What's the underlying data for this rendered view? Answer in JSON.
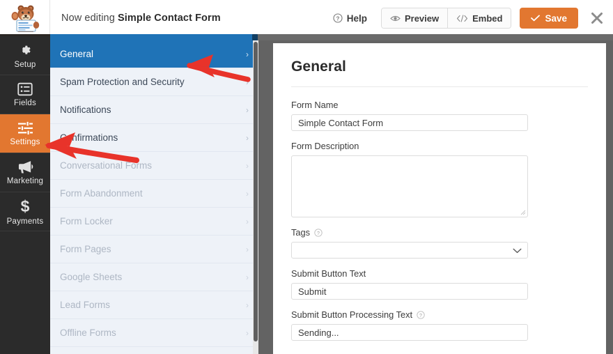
{
  "header": {
    "logo_name": "wpforms-bear-logo",
    "editing_prefix": "Now editing",
    "form_title": "Simple Contact Form",
    "help_label": "Help",
    "preview_label": "Preview",
    "embed_label": "Embed",
    "save_label": "Save",
    "close_label": "×"
  },
  "colors": {
    "accent_orange": "#e27730",
    "active_blue": "#1f73b7",
    "rail_dark": "#2b2b2b",
    "panel_bg": "#eef2f8",
    "frame_gray": "#636363",
    "arrow_red": "#e8332a"
  },
  "rail": {
    "items": [
      {
        "label": "Setup",
        "icon": "gear-icon",
        "active": false
      },
      {
        "label": "Fields",
        "icon": "form-list-icon",
        "active": false
      },
      {
        "label": "Settings",
        "icon": "sliders-icon",
        "active": true
      },
      {
        "label": "Marketing",
        "icon": "megaphone-icon",
        "active": false
      },
      {
        "label": "Payments",
        "icon": "dollar-icon",
        "active": false
      }
    ]
  },
  "settings_list": {
    "items": [
      {
        "label": "General",
        "active": true,
        "disabled": false
      },
      {
        "label": "Spam Protection and Security",
        "active": false,
        "disabled": false
      },
      {
        "label": "Notifications",
        "active": false,
        "disabled": false
      },
      {
        "label": "Confirmations",
        "active": false,
        "disabled": false
      },
      {
        "label": "Conversational Forms",
        "active": false,
        "disabled": true
      },
      {
        "label": "Form Abandonment",
        "active": false,
        "disabled": true
      },
      {
        "label": "Form Locker",
        "active": false,
        "disabled": true
      },
      {
        "label": "Form Pages",
        "active": false,
        "disabled": true
      },
      {
        "label": "Google Sheets",
        "active": false,
        "disabled": true
      },
      {
        "label": "Lead Forms",
        "active": false,
        "disabled": true
      },
      {
        "label": "Offline Forms",
        "active": false,
        "disabled": true
      }
    ],
    "chevron": "›"
  },
  "content": {
    "title": "General",
    "fields": {
      "form_name": {
        "label": "Form Name",
        "value": "Simple Contact Form",
        "placeholder": ""
      },
      "form_description": {
        "label": "Form Description",
        "value": "",
        "placeholder": ""
      },
      "tags": {
        "label": "Tags",
        "value": "",
        "placeholder": "",
        "has_help": true
      },
      "submit_button_text": {
        "label": "Submit Button Text",
        "value": "Submit",
        "placeholder": ""
      },
      "submit_button_processing_text": {
        "label": "Submit Button Processing Text",
        "value": "Sending...",
        "placeholder": "",
        "has_help": true
      }
    }
  },
  "annotations": {
    "arrow_general": "red-arrow-pointing-to-general",
    "arrow_settings": "red-arrow-pointing-to-settings"
  }
}
